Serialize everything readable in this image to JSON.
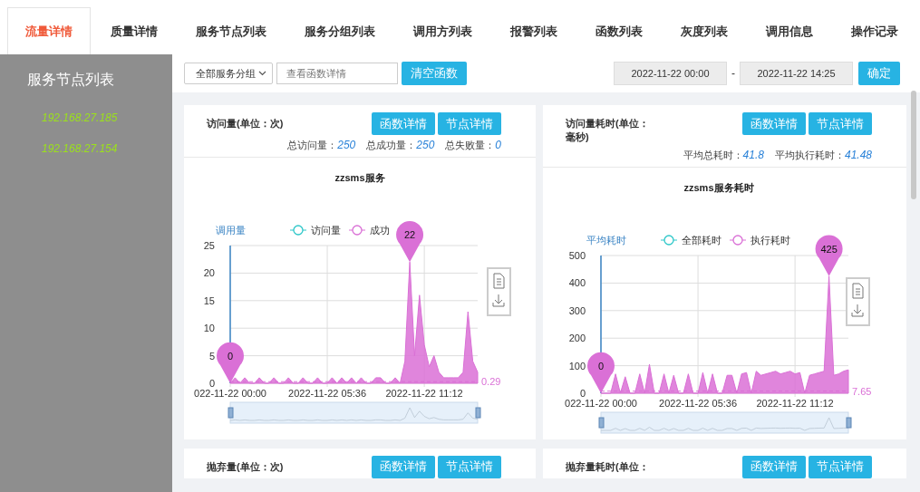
{
  "tabs": [
    {
      "label": "流量详情",
      "selected": true
    },
    {
      "label": "质量详情",
      "selected": false
    },
    {
      "label": "服务节点列表",
      "selected": false
    },
    {
      "label": "服务分组列表",
      "selected": false
    },
    {
      "label": "调用方列表",
      "selected": false
    },
    {
      "label": "报警列表",
      "selected": false
    },
    {
      "label": "函数列表",
      "selected": false
    },
    {
      "label": "灰度列表",
      "selected": false
    },
    {
      "label": "调用信息",
      "selected": false
    },
    {
      "label": "操作记录",
      "selected": false
    }
  ],
  "sidebar": {
    "title": "服务节点列表",
    "items": [
      "192.168.27.185",
      "192.168.27.154"
    ]
  },
  "toolbar": {
    "group_select": "全部服务分组",
    "function_search": {
      "placeholder": "查看函数详情"
    },
    "clear_button": "清空函数",
    "start_time": "2022-11-22 00:00",
    "separator": "-",
    "end_time": "2022-11-22 14:25",
    "confirm_button": "确定"
  },
  "cards": [
    {
      "title": "访问量(单位：次)",
      "buttons": [
        "函数详情",
        "节点详情"
      ],
      "stats": [
        {
          "label": "总访问量：",
          "value": "250"
        },
        {
          "label": "总成功量：",
          "value": "250"
        },
        {
          "label": "总失败量：",
          "value": "0"
        }
      ],
      "chart_data": {
        "type": "area",
        "title": "zzsms服务",
        "ylabel": "调用量",
        "legend": "top",
        "grid": true,
        "ylim": [
          0,
          25
        ],
        "yticks": [
          0,
          5,
          10,
          15,
          20,
          25
        ],
        "categories": [
          "022-11-22 00:00",
          null,
          null,
          null,
          null,
          null,
          null,
          null,
          null,
          null,
          null,
          null,
          null,
          null,
          null,
          null,
          null,
          null,
          null,
          null,
          "2022-11-22 05:36",
          null,
          null,
          null,
          null,
          null,
          null,
          null,
          null,
          null,
          null,
          null,
          null,
          null,
          null,
          null,
          null,
          null,
          null,
          null,
          "2022-11-22 11:12",
          null,
          null,
          null,
          null,
          null,
          null,
          null,
          null,
          null,
          null,
          null
        ],
        "series": [
          {
            "name": "访问量",
            "color": "#2ec7c9",
            "values": [
              null,
              null,
              null,
              null,
              null,
              null,
              null,
              null,
              null,
              null,
              null,
              null,
              null,
              null,
              null,
              null,
              null,
              null,
              null,
              null,
              null,
              null,
              null,
              null,
              null,
              null,
              null,
              null,
              null,
              null,
              null,
              null,
              null,
              null,
              null,
              null,
              null,
              null,
              null,
              null,
              null,
              null,
              null,
              null,
              null,
              null,
              null,
              null,
              null,
              null,
              null,
              null
            ]
          },
          {
            "name": "成功",
            "color": "#da70d6",
            "values": [
              0,
              1,
              0,
              1,
              0,
              0,
              1,
              0,
              0,
              1,
              0,
              0,
              1,
              0,
              0,
              1,
              0,
              0,
              1,
              0,
              0,
              1,
              0,
              1,
              0,
              1,
              0,
              1,
              0,
              0,
              1,
              1,
              0,
              0,
              1,
              0,
              4,
              22,
              5,
              16,
              7,
              3,
              5,
              2,
              1,
              1,
              1,
              1,
              2,
              13,
              4,
              2
            ]
          }
        ],
        "annotations": [
          {
            "y": 22,
            "text": "22"
          },
          {
            "y": 0,
            "text": "0"
          }
        ],
        "ref_lines": [
          {
            "label": "0.29"
          }
        ]
      }
    },
    {
      "title": "访问量耗时(单位：毫秒)",
      "buttons": [
        "函数详情",
        "节点详情"
      ],
      "stats": [
        {
          "label": "平均总耗时：",
          "value": "41.8"
        },
        {
          "label": "平均执行耗时：",
          "value": "41.48"
        }
      ],
      "chart_data": {
        "type": "area",
        "title": "zzsms服务耗时",
        "ylabel": "平均耗时",
        "legend": "top",
        "grid": true,
        "ylim": [
          0,
          500
        ],
        "yticks": [
          0,
          100,
          200,
          300,
          400,
          500
        ],
        "categories": [
          "022-11-22 00:00",
          null,
          null,
          null,
          null,
          null,
          null,
          null,
          null,
          null,
          null,
          null,
          null,
          null,
          null,
          null,
          null,
          null,
          null,
          null,
          "2022-11-22 05:36",
          null,
          null,
          null,
          null,
          null,
          null,
          null,
          null,
          null,
          null,
          null,
          null,
          null,
          null,
          null,
          null,
          null,
          null,
          null,
          "2022-11-22 11:12",
          null,
          null,
          null,
          null,
          null,
          null,
          null,
          null,
          null,
          null,
          null
        ],
        "series": [
          {
            "name": "全部耗时",
            "color": "#2ec7c9",
            "values": [
              null,
              null,
              null,
              null,
              null,
              null,
              null,
              null,
              null,
              null,
              null,
              null,
              null,
              null,
              null,
              null,
              null,
              null,
              null,
              null,
              null,
              null,
              null,
              null,
              null,
              null,
              null,
              null,
              null,
              null,
              null,
              null,
              null,
              null,
              null,
              null,
              null,
              null,
              null,
              null,
              null,
              null,
              null,
              null,
              null,
              null,
              null,
              null,
              null,
              null,
              null,
              null
            ]
          },
          {
            "name": "执行耗时",
            "color": "#da70d6",
            "values": [
              0,
              null,
              0,
              70,
              0,
              60,
              0,
              0,
              70,
              0,
              105,
              0,
              0,
              70,
              0,
              65,
              0,
              0,
              70,
              0,
              0,
              75,
              0,
              70,
              0,
              0,
              65,
              65,
              0,
              70,
              75,
              0,
              80,
              65,
              70,
              75,
              80,
              70,
              75,
              80,
              70,
              75,
              0,
              65,
              70,
              75,
              80,
              425,
              65,
              70,
              80,
              85
            ]
          }
        ],
        "annotations": [
          {
            "y": 425,
            "text": "425"
          },
          {
            "y": 0,
            "text": "0"
          }
        ],
        "ref_lines": [
          {
            "label": "7.65"
          }
        ]
      }
    },
    {
      "title": "抛弃量(单位：次)",
      "buttons": [
        "函数详情",
        "节点详情"
      ]
    },
    {
      "title": "抛弃量耗时(单位：",
      "buttons": [
        "函数详情",
        "节点详情"
      ]
    }
  ]
}
